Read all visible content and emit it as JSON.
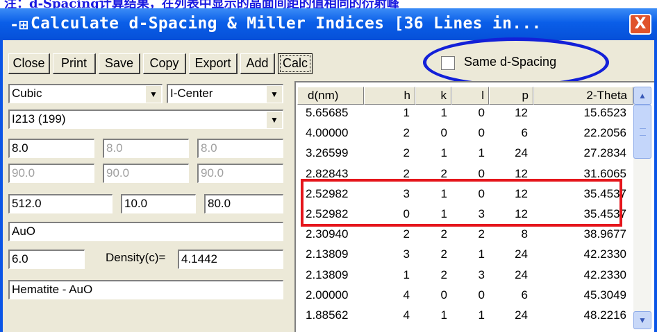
{
  "top_strip_text": "注：d-Spacing计算结果，在列表中显示的晶面间距的值相同的衍射峰",
  "window": {
    "title_icon": "-⊞",
    "title": "Calculate d-Spacing & Miller Indices [36 Lines in...",
    "close_symbol": "X"
  },
  "toolbar": {
    "close": "Close",
    "print": "Print",
    "save": "Save",
    "copy": "Copy",
    "export": "Export",
    "add": "Add",
    "calc": "Calc"
  },
  "same_spacing": {
    "label": "Same d-Spacing",
    "checked": false
  },
  "form": {
    "crystal_system": "Cubic",
    "centering": "I-Center",
    "space_group": "I213 (199)",
    "a": "8.0",
    "b": "8.0",
    "c": "8.0",
    "alpha": "90.0",
    "beta": "90.0",
    "gamma": "90.0",
    "field1": "512.0",
    "field2": "10.0",
    "field3": "80.0",
    "formula": "AuO",
    "z": "6.0",
    "density_label": "Density(c)=",
    "density": "4.1442",
    "name": "Hematite - AuO"
  },
  "table": {
    "headers": [
      "d(nm)",
      "h",
      "k",
      "l",
      "p",
      "2-Theta"
    ],
    "rows": [
      [
        "5.65685",
        "1",
        "1",
        "0",
        "12",
        "15.6523"
      ],
      [
        "4.00000",
        "2",
        "0",
        "0",
        "6",
        "22.2056"
      ],
      [
        "3.26599",
        "2",
        "1",
        "1",
        "24",
        "27.2834"
      ],
      [
        "2.82843",
        "2",
        "2",
        "0",
        "12",
        "31.6065"
      ],
      [
        "2.52982",
        "3",
        "1",
        "0",
        "12",
        "35.4537"
      ],
      [
        "2.52982",
        "0",
        "1",
        "3",
        "12",
        "35.4537"
      ],
      [
        "2.30940",
        "2",
        "2",
        "2",
        "8",
        "38.9677"
      ],
      [
        "2.13809",
        "3",
        "2",
        "1",
        "24",
        "42.2330"
      ],
      [
        "2.13809",
        "1",
        "2",
        "3",
        "24",
        "42.2330"
      ],
      [
        "2.00000",
        "4",
        "0",
        "0",
        "6",
        "45.3049"
      ],
      [
        "1.88562",
        "4",
        "1",
        "1",
        "24",
        "48.2216"
      ]
    ]
  },
  "colors": {
    "titlebar": "#0a5ee8",
    "highlight_box": "#e5151b",
    "annotation_ellipse": "#1320d8"
  }
}
